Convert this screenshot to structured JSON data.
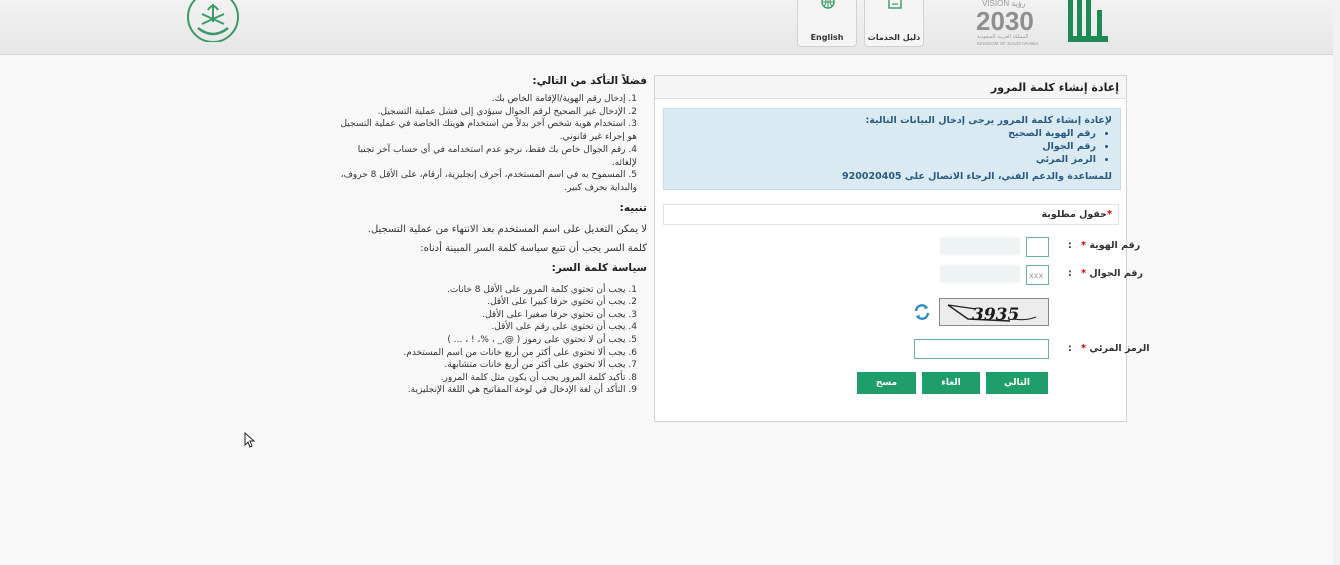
{
  "header": {
    "services_guide_label": "دليل الخدمات",
    "english_label": "English",
    "vision_brand": "VISION رؤية",
    "vision_year": "2030",
    "vision_kingdom_ar": "المملكة العربية السعودية",
    "vision_kingdom_en": "KINGDOM OF SAUDI ARABIA"
  },
  "info": {
    "check_title": "فضلاً التأكد من التالي:",
    "check_items": [
      "1. إدخال رقم الهوية/الإقامة الخاص بك.",
      "2. الإدخال غير الصحيح لرقم الجوال سيؤدي إلى فشل عملية التسجيل.",
      "3. استخدام هوية شخص آخر بدلاً من استخدام هويتك الخاصة في عملية التسجيل هو إجراء غير قانوني.",
      "4. رقم الجوال خاص بك فقط، نرجو عدم استخدامه في أي حساب آخر تجنبا لإلغائه.",
      "5. المسموح به في اسم المستخدم، أحرف إنجليزية، أرقام، على الأقل 8 حروف، والبداية بحرف كبير."
    ],
    "warning_title": "تنبيه:",
    "warning_text": "لا يمكن التعديل على اسم المستخدم بعد الانتهاء من عملية التسجيل.",
    "policy_intro": "كلمة السر يجب أن تتبع سياسة كلمة السر المبينة أدناه:",
    "policy_title": "سياسة كلمة السر:",
    "policy_items": [
      "1. يجب أن تحتوي كلمة المرور على الأقل 8 خانات.",
      "2. يجب أن تحتوي حرفا كبيرا على الأقل.",
      "3. يجب أن تحتوي حرفا صغيرا على الأقل.",
      "4. يجب أن تحتوي على رقم على الأقل.",
      "5. يجب أن لا تحتوي على رموز ( @,_ ، %، ! ، ... )",
      "6. يجب ألا تحتوي على أكثر من أربع خانات من اسم المستخدم.",
      "7. يجب ألا تحتوي على أكثر من أربع خانات متشابهة.",
      "8. تأكيد كلمة المرور يجب أن يكون مثل كلمة المرور.",
      "9. التأكد أن لغة الإدخال في لوحة المفاتيح هي اللغة الإنجليزية."
    ]
  },
  "form": {
    "title": "إعادة إنشاء كلمة المرور",
    "notice_intro": "لإعادة إنشاء كلمة المرور يرجى إدخال البيانات التالية:",
    "notice_items": [
      "رقم الهوية الصحيح",
      "رقم الجوال",
      "الرمز المرئي"
    ],
    "support_text": "للمساعدة والدعم الفني، الرجاء الاتصال على 920020405",
    "required_note": "حقول مطلوبة",
    "id_label": "رقم الهوية",
    "mobile_label": "رقم الجوال",
    "mobile_value": "xxx",
    "captcha_label": "الرمز المرئي",
    "captcha_text": "3935",
    "colon": ":",
    "star": "*",
    "next_button": "التالي",
    "cancel_button": "الغاء",
    "clear_button": "مسح"
  },
  "colors": {
    "primary_green": "#1f9e6b",
    "notice_bg": "#d9eaf2",
    "notice_text": "#2a5b84",
    "required_star": "#cc0000"
  }
}
